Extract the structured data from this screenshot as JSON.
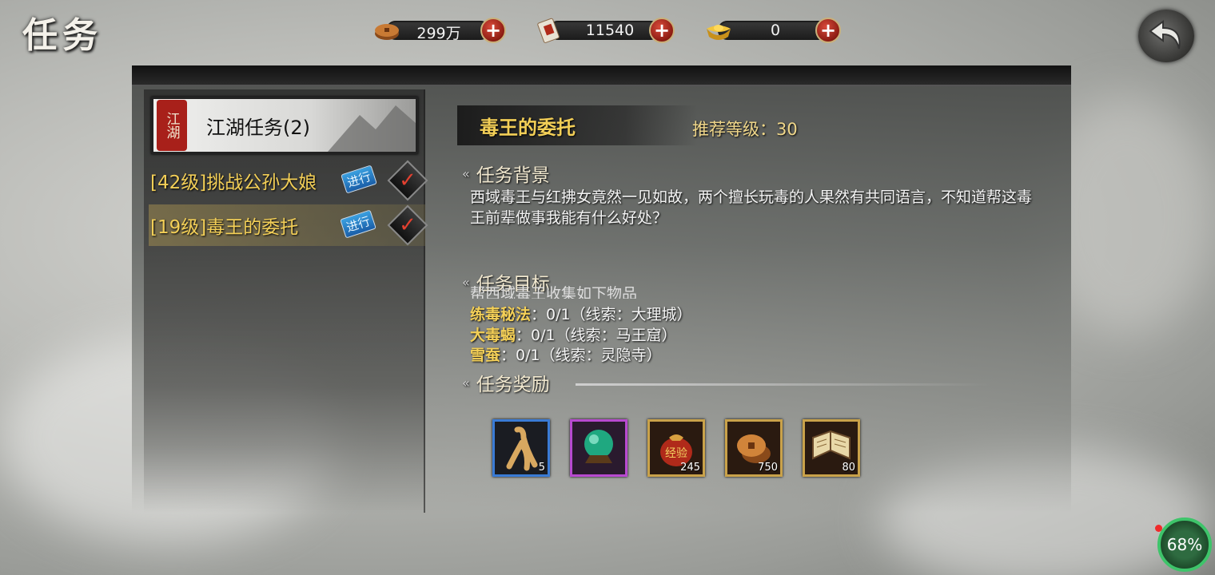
{
  "page_title": "任务",
  "resources": {
    "copper": {
      "value": "299万",
      "icon": "copper-coin-icon"
    },
    "tokens": {
      "value": "11540",
      "icon": "token-card-icon"
    },
    "gold": {
      "value": "0",
      "icon": "gold-ingot-icon"
    }
  },
  "category": {
    "seal": "江湖",
    "label": "江湖任务(2)"
  },
  "quests": [
    {
      "label": "[42级]挑战公孙大娘",
      "badge": "进行"
    },
    {
      "label": "[19级]毒王的委托",
      "badge": "进行"
    }
  ],
  "detail": {
    "title": "毒王的委托",
    "recommend_label": "推荐等级：",
    "recommend_level": "30",
    "background_head": "任务背景",
    "background_text": "西域毒王与红拂女竟然一见如故，两个擅长玩毒的人果然有共同语言，不知道帮这毒王前辈做事我能有什么好处？",
    "objective_head": "任务目标",
    "objective_cut": "帮西域毒王收集如下物品",
    "objectives": [
      {
        "item": "练毒秘法",
        "rest": "：0/1（线索：大理城）"
      },
      {
        "item": "大毒蝎",
        "rest": "：0/1（线索：马王窟）"
      },
      {
        "item": "雪蚕",
        "rest": "：0/1（线索：灵隐寺）"
      }
    ],
    "reward_head": "任务奖励",
    "rewards": [
      {
        "icon": "ginseng-icon",
        "count": "5",
        "border": "#3a7bd5"
      },
      {
        "icon": "jade-orb-icon",
        "count": "",
        "border": "#b84ad0"
      },
      {
        "icon": "experience-pouch-icon",
        "count": "245",
        "border": "#c9a24a"
      },
      {
        "icon": "copper-coins-icon",
        "count": "750",
        "border": "#c9a24a"
      },
      {
        "icon": "scroll-book-icon",
        "count": "80",
        "border": "#c9a24a"
      }
    ]
  },
  "battery": "68%"
}
